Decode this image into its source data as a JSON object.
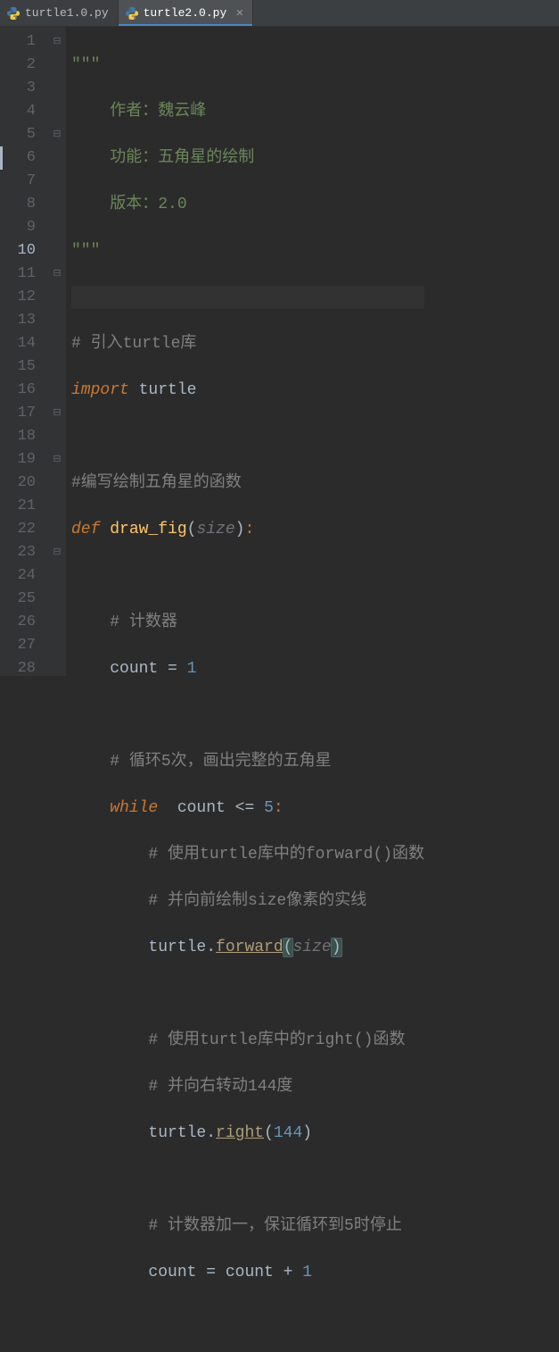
{
  "tabs": [
    {
      "label": "turtle1.0.py",
      "active": false
    },
    {
      "label": "turtle2.0.py",
      "active": true
    }
  ],
  "current_line": 10,
  "code": {
    "l1": {
      "txt": "\"\"\""
    },
    "l2": {
      "txt": "作者：魏云峰"
    },
    "l3": {
      "txt": "功能：五角星的绘制"
    },
    "l4": {
      "txt": "版本：2.0"
    },
    "l5": {
      "txt": "\"\"\""
    },
    "l7": {
      "txt": "# 引入turtle库"
    },
    "l8a": "import",
    "l8b": " turtle",
    "l10": {
      "txt": "#编写绘制五角星的函数"
    },
    "l11a": "def ",
    "l11b": "draw_fig",
    "l11c": "size",
    "l13": {
      "txt": "# 计数器"
    },
    "l14a": "count ",
    "l14b": "= ",
    "l14c": "1",
    "l16": {
      "txt": "# 循环5次，画出完整的五角星"
    },
    "l17a": "while ",
    "l17b": " count ",
    "l17c": "<= ",
    "l17d": "5",
    "l18": {
      "txt": "# 使用turtle库中的forward()函数"
    },
    "l19": {
      "txt": "# 并向前绘制size像素的实线"
    },
    "l20a": "turtle.",
    "l20b": "forward",
    "l20c": "size",
    "l22": {
      "txt": "# 使用turtle库中的right()函数"
    },
    "l23": {
      "txt": "# 并向右转动144度"
    },
    "l24a": "turtle.",
    "l24b": "right",
    "l24c": "144",
    "l26": {
      "txt": "# 计数器加一，保证循环到5时停止"
    },
    "l27a": "count ",
    "l27b": "= ",
    "l27c": "count ",
    "l27d": "+ ",
    "l27e": "1"
  },
  "line_numbers": [
    "1",
    "2",
    "3",
    "4",
    "5",
    "6",
    "7",
    "8",
    "9",
    "10",
    "11",
    "12",
    "13",
    "14",
    "15",
    "16",
    "17",
    "18",
    "19",
    "20",
    "21",
    "22",
    "23",
    "24",
    "25",
    "26",
    "27",
    "28"
  ],
  "folds": [
    "⊟",
    "",
    "",
    "",
    "⊟",
    "",
    "",
    "",
    "",
    "",
    "⊟",
    "",
    "",
    "",
    "",
    "",
    "⊟",
    "",
    "⊟",
    "",
    "",
    "",
    "⊟",
    "",
    "",
    "",
    "",
    ""
  ]
}
